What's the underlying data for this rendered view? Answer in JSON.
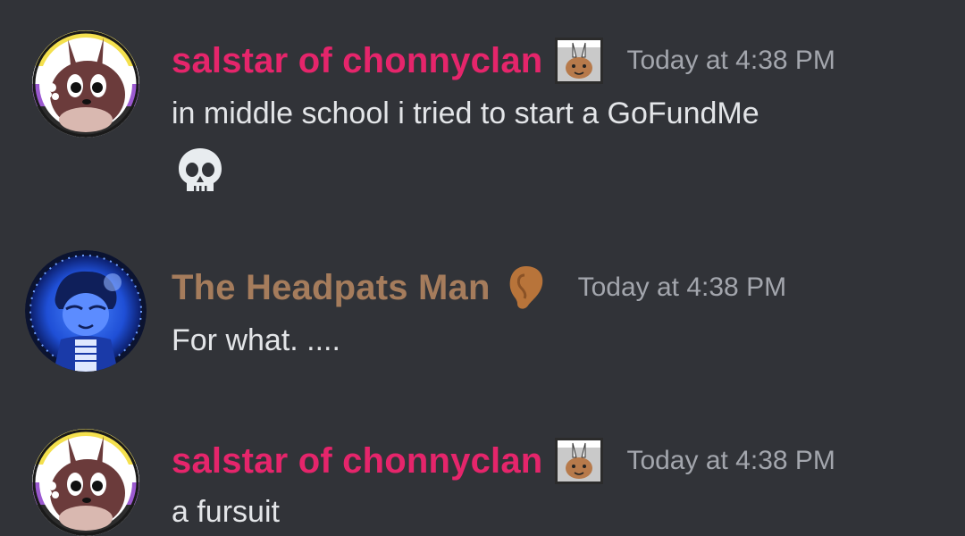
{
  "colors": {
    "background": "#313338",
    "salstar_name": "#e5256b",
    "headpats_name": "#a57c5c",
    "timestamp": "#a3a6ad",
    "message_text": "#e3e5e8"
  },
  "messages": [
    {
      "username": "salstar of chonnyclan",
      "badge_icon": "bunny-cat-badge-icon",
      "timestamp": "Today at 4:38 PM",
      "text": "in middle school i tried to start a GoFundMe",
      "emoji": "skull-emoji-icon"
    },
    {
      "username": "The Headpats Man",
      "badge_icon": "ear-icon",
      "timestamp": "Today at 4:38 PM",
      "text": "For what. ...."
    },
    {
      "username": "salstar of chonnyclan",
      "badge_icon": "bunny-cat-badge-icon",
      "timestamp": "Today at 4:38 PM",
      "text": "a fursuit"
    }
  ]
}
